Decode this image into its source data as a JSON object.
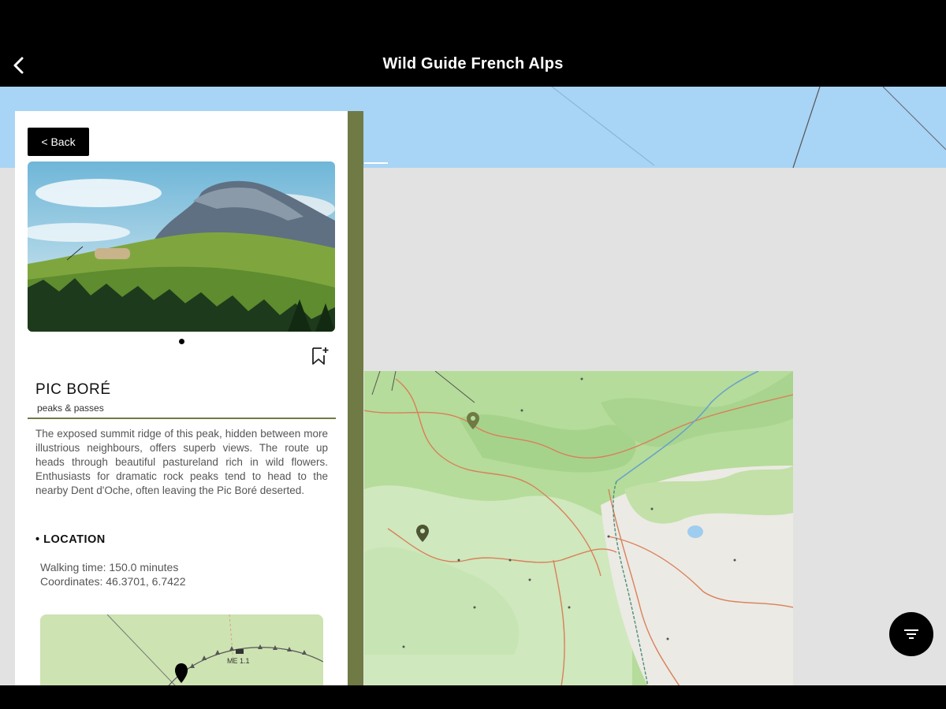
{
  "header": {
    "title": "Wild Guide French Alps"
  },
  "panel": {
    "back_label": "< Back",
    "place_name": "PIC BORÉ",
    "category": "peaks & passes",
    "description": "The exposed summit ridge of this peak, hidden between more illustrious neighbours, offers superb views. The route up heads through beautiful pastureland rich in wild flowers. Enthusiasts for dramatic rock peaks tend to head to the nearby Dent d'Oche, often leaving the Pic Boré deserted.",
    "location_heading": "• LOCATION",
    "walking_time": "Walking time: 150.0 minutes",
    "coordinates": "Coordinates: 46.3701, 6.7422",
    "mini_map_label": "ME 1.1"
  },
  "colors": {
    "accent_olive": "#6f7a45",
    "map_green": "#b5dc9a",
    "sky_blue": "#a8d4f5",
    "route_red": "#d9805a"
  },
  "icons": {
    "back": "chevron-left-icon",
    "bookmark": "bookmark-add-icon",
    "filter": "filter-icon",
    "map_pin": "map-pin-icon"
  }
}
